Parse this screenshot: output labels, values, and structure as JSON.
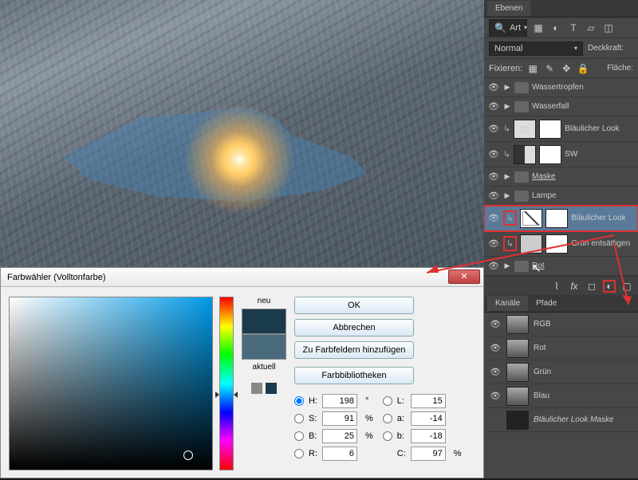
{
  "layers_panel": {
    "tab": "Ebenen",
    "filter_label": "Art",
    "blend_mode": "Normal",
    "opacity_label": "Deckkraft:",
    "lock_label": "Fixieren:",
    "fill_label": "Fläche:",
    "items": [
      {
        "type": "group",
        "name": "Wassertropfen"
      },
      {
        "type": "group",
        "name": "Wasserfall"
      },
      {
        "type": "adj",
        "name": "Bläulicher Look",
        "icon": "balance"
      },
      {
        "type": "adj",
        "name": "SW",
        "icon": "bw"
      },
      {
        "type": "group",
        "name": "Maske",
        "ul": true
      },
      {
        "type": "group",
        "name": "Lampe"
      },
      {
        "type": "adj",
        "name": "Bläulicher Look",
        "icon": "curves",
        "hl": true,
        "sel": true,
        "clip_hl": true
      },
      {
        "type": "adj",
        "name": "Grün entsättigen",
        "icon": "hs",
        "clip_hl": true
      },
      {
        "type": "group",
        "name": "Rot",
        "ul": true
      }
    ],
    "footer_hl": true
  },
  "channels_panel": {
    "tabs": [
      "Kanäle",
      "Pfade"
    ],
    "active": 0,
    "items": [
      "RGB",
      "Rot",
      "Grün",
      "Blau",
      "Bläulicher Look Maske"
    ]
  },
  "picker": {
    "title": "Farbwähler (Volltonfarbe)",
    "new_label": "neu",
    "current_label": "aktuell",
    "new_color": "#1a3b4d",
    "current_color": "#4a6b7d",
    "buttons": {
      "ok": "OK",
      "cancel": "Abbrechen",
      "add": "Zu Farbfeldern hinzufügen",
      "libs": "Farbbibliotheken"
    },
    "hsb": {
      "H": "198",
      "S": "91",
      "B": "25"
    },
    "rgb": {
      "R": "6"
    },
    "lab": {
      "L": "15",
      "a": "-14",
      "b": "-18"
    },
    "cmyk": {
      "C": "97"
    },
    "marker_hl": true
  }
}
